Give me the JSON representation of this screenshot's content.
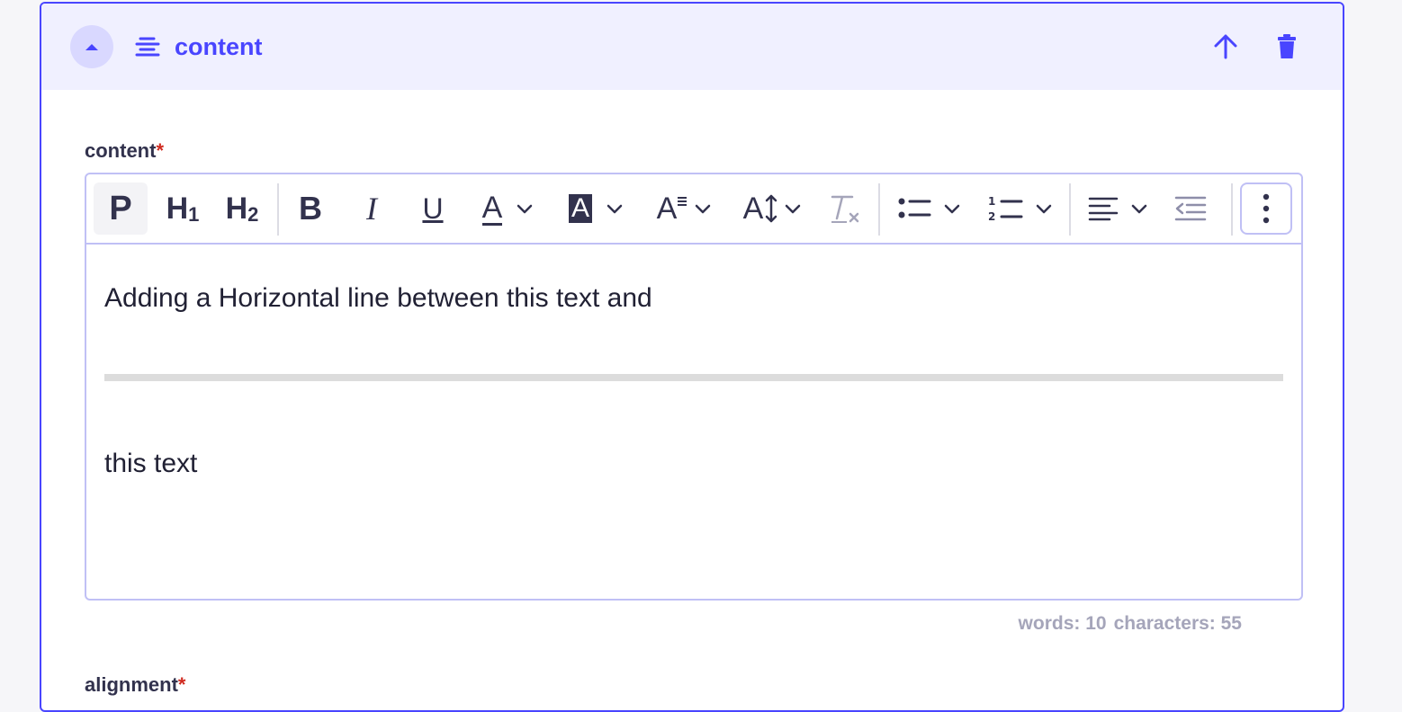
{
  "block": {
    "title": "content",
    "collapse_icon": "caret-up-icon",
    "type_icon": "text-align-icon",
    "move_up_icon": "arrow-up-icon",
    "delete_icon": "trash-icon"
  },
  "field": {
    "label": "content",
    "required": "*"
  },
  "toolbar": {
    "paragraph": "P",
    "heading1": "H",
    "heading1_sub": "1",
    "heading2": "H",
    "heading2_sub": "2",
    "bold": "B",
    "italic": "I",
    "underline": "U",
    "font_color": "A",
    "background_color": "A",
    "font_size": "A",
    "line_height": "A",
    "clear_format_icon": "clear-formatting-icon",
    "bullet_list_icon": "bullet-list-icon",
    "numbered_list_icon": "numbered-list-icon",
    "align_icon": "align-left-icon",
    "outdent_icon": "outdent-icon",
    "more_icon": "more-vertical-icon"
  },
  "editor": {
    "line1": "Adding a Horizontal line between this text and",
    "line2": "this text"
  },
  "counter": {
    "words": "words: 10",
    "characters": "characters: 55"
  },
  "next_field": {
    "label": "alignment",
    "required": "*"
  },
  "colors": {
    "accent": "#4945ff",
    "header_bg": "#f0f0ff",
    "collapse_bg": "#d9d8ff",
    "text": "#32324d",
    "required": "#d02b20",
    "muted": "#a5a5ba"
  }
}
